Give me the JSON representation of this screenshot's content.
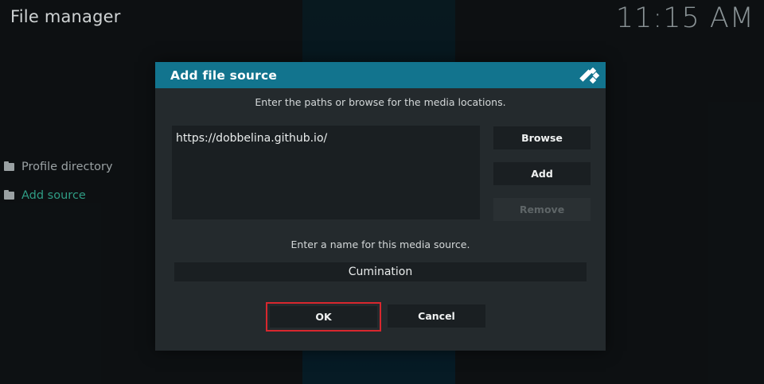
{
  "app": {
    "title": "File manager",
    "clock": "11:15 AM"
  },
  "sidebar": {
    "items": [
      {
        "label": "Profile directory",
        "icon": "folder-icon",
        "active": false
      },
      {
        "label": "Add source",
        "icon": "folder-icon",
        "active": true
      }
    ]
  },
  "dialog": {
    "title": "Add file source",
    "paths_hint": "Enter the paths or browse for the media locations.",
    "paths": [
      "https://dobbelina.github.io/"
    ],
    "browse_label": "Browse",
    "add_label": "Add",
    "remove_label": "Remove",
    "name_hint": "Enter a name for this media source.",
    "name_value": "Cumination",
    "ok_label": "OK",
    "cancel_label": "Cancel"
  },
  "colors": {
    "header": "#12748e",
    "active_item": "#2f9c84",
    "focus_outline": "#d8272e"
  }
}
